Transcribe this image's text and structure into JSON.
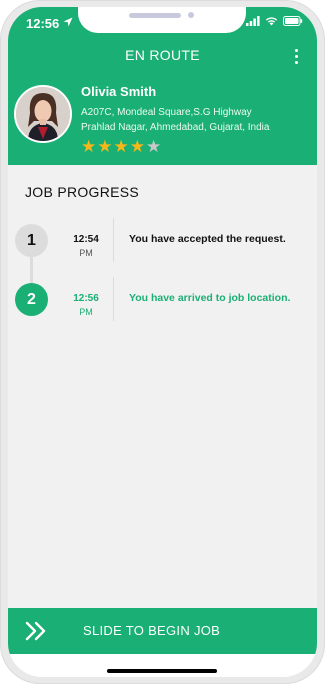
{
  "status_bar": {
    "time": "12:56",
    "icons": [
      "location-arrow-icon",
      "signal-icon",
      "wifi-icon",
      "battery-icon"
    ]
  },
  "header": {
    "title": "EN ROUTE",
    "menu_icon": "more-vertical-icon"
  },
  "user": {
    "name": "Olivia Smith",
    "address_line1": "A207C, Mondeal Square,S.G Highway",
    "address_line2": "Prahlad Nagar, Ahmedabad, Gujarat, India",
    "rating": 4,
    "rating_max": 5
  },
  "job_progress": {
    "title": "JOB PROGRESS",
    "steps": [
      {
        "number": "1",
        "time": "12:54",
        "ampm": "PM",
        "text": "You have accepted the request."
      },
      {
        "number": "2",
        "time": "12:56",
        "ampm": "PM",
        "text": "You have arrived to job location."
      }
    ]
  },
  "slide_action": {
    "label": "SLIDE TO BEGIN JOB",
    "icon": "double-chevron-right-icon"
  },
  "colors": {
    "brand_green": "#1aaf74",
    "star_filled": "#f7b718",
    "star_empty": "#c8c8c8",
    "background": "#f1f1f1"
  }
}
